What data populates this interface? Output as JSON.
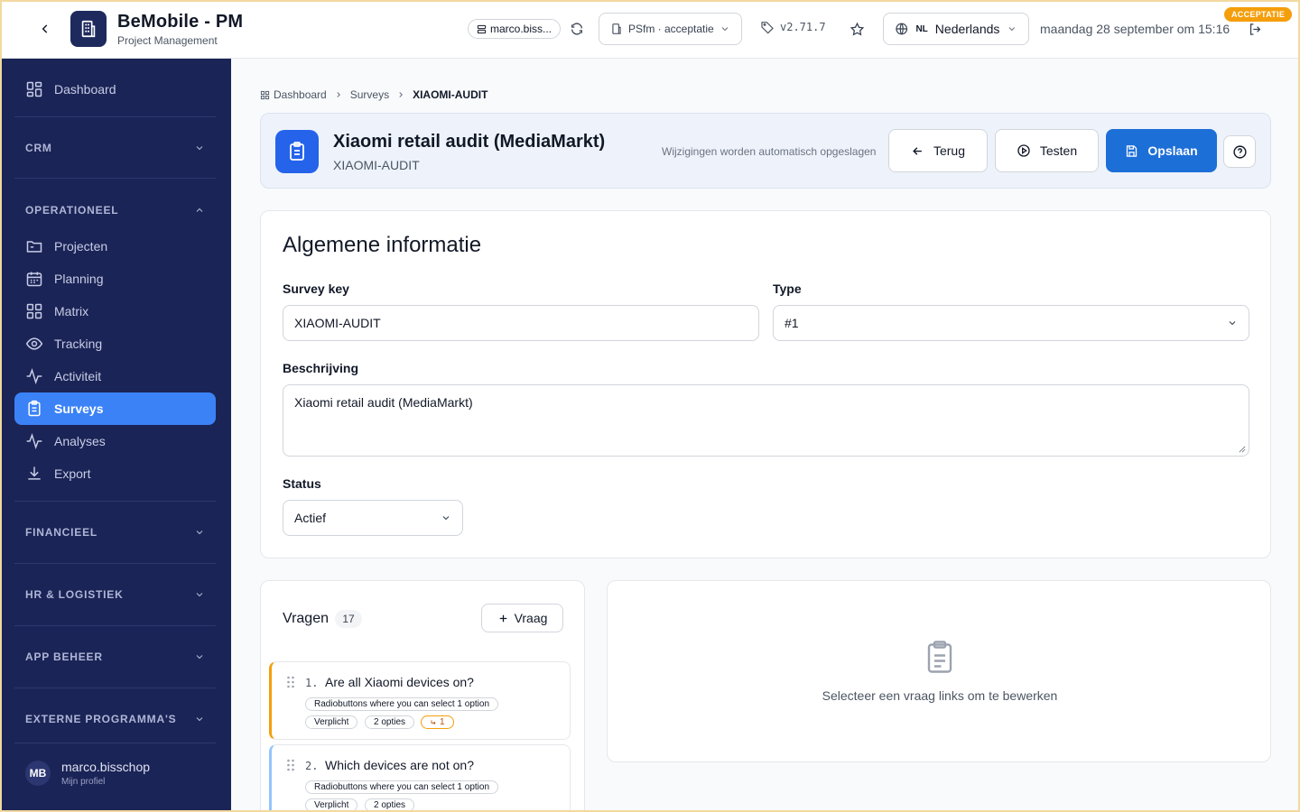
{
  "app": {
    "title": "BeMobile - PM",
    "subtitle": "Project Management"
  },
  "topbar": {
    "user_chip": "marco.biss...",
    "environment": "PSfm · acceptatie",
    "version": "v2.71.7",
    "language_code": "NL",
    "language": "Nederlands",
    "datetime": "maandag 28 september om 15:16",
    "env_badge": "ACCEPTATIE"
  },
  "sidebar": {
    "dashboard": "Dashboard",
    "sections": {
      "crm": "CRM",
      "operationeel": "OPERATIONEEL",
      "financieel": "FINANCIEEL",
      "hr": "HR & LOGISTIEK",
      "app": "APP BEHEER",
      "externe": "EXTERNE PROGRAMMA'S"
    },
    "items": [
      {
        "label": "Projecten",
        "icon": "folder-icon"
      },
      {
        "label": "Planning",
        "icon": "calendar-icon"
      },
      {
        "label": "Matrix",
        "icon": "grid-icon"
      },
      {
        "label": "Tracking",
        "icon": "eye-icon"
      },
      {
        "label": "Activiteit",
        "icon": "activity-icon"
      },
      {
        "label": "Surveys",
        "icon": "clipboard-icon",
        "active": true
      },
      {
        "label": "Analyses",
        "icon": "activity-icon"
      },
      {
        "label": "Export",
        "icon": "download-icon"
      }
    ],
    "profile": {
      "initials": "MB",
      "name": "marco.bisschop",
      "sub": "Mijn profiel"
    }
  },
  "breadcrumb": {
    "items": [
      "Dashboard",
      "Surveys"
    ],
    "current": "XIAOMI-AUDIT"
  },
  "header": {
    "title": "Xiaomi retail audit (MediaMarkt)",
    "key": "XIAOMI-AUDIT",
    "autosave": "Wijzigingen worden automatisch opgeslagen",
    "back_label": "Terug",
    "test_label": "Testen",
    "save_label": "Opslaan"
  },
  "general": {
    "title": "Algemene informatie",
    "survey_key_label": "Survey key",
    "survey_key_value": "XIAOMI-AUDIT",
    "type_label": "Type",
    "type_value": "#1",
    "description_label": "Beschrijving",
    "description_value": "Xiaomi retail audit (MediaMarkt)",
    "status_label": "Status",
    "status_value": "Actief"
  },
  "questions": {
    "heading": "Vragen",
    "count": "17",
    "add_label": "Vraag",
    "items": [
      {
        "num": "1.",
        "text": "Are all Xiaomi devices on?",
        "type": "Radiobuttons where you can select 1 option",
        "required": "Verplicht",
        "options": "2 opties",
        "condition": "1"
      },
      {
        "num": "2.",
        "text": "Which devices are not on?",
        "type": "Radiobuttons where you can select 1 option",
        "required": "Verplicht",
        "options": "2 opties"
      }
    ]
  },
  "editor": {
    "empty_text": "Selecteer een vraag links om te bewerken"
  },
  "colors": {
    "sidebar": "#1b2456",
    "active": "#3b82f6",
    "primary": "#1d6fd8",
    "badge": "#f59e0b"
  }
}
